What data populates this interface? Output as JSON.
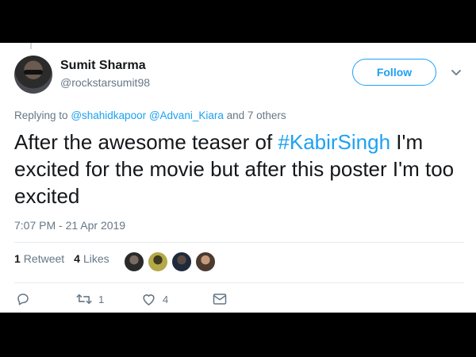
{
  "tweet": {
    "author": {
      "display_name": "Sumit Sharma",
      "handle": "@rockstarsumit98"
    },
    "follow_label": "Follow",
    "replying": {
      "prefix": "Replying to",
      "mention_1": "@shahidkapoor",
      "mention_2": "@Advani_Kiara",
      "suffix": "and 7 others"
    },
    "text": {
      "part1": "After the awesome teaser of ",
      "hashtag": "#KabirSingh",
      "part2": " I'm excited for the movie but after this poster I'm too excited"
    },
    "timestamp": "7:07 PM - 21 Apr 2019",
    "stats": {
      "retweets_count": "1",
      "retweets_label": "Retweet",
      "likes_count": "4",
      "likes_label": "Likes"
    },
    "actions": {
      "retweet_count": "1",
      "like_count": "4"
    },
    "colors": {
      "accent": "#1da1f2",
      "text": "#14171a",
      "muted": "#657786"
    }
  }
}
